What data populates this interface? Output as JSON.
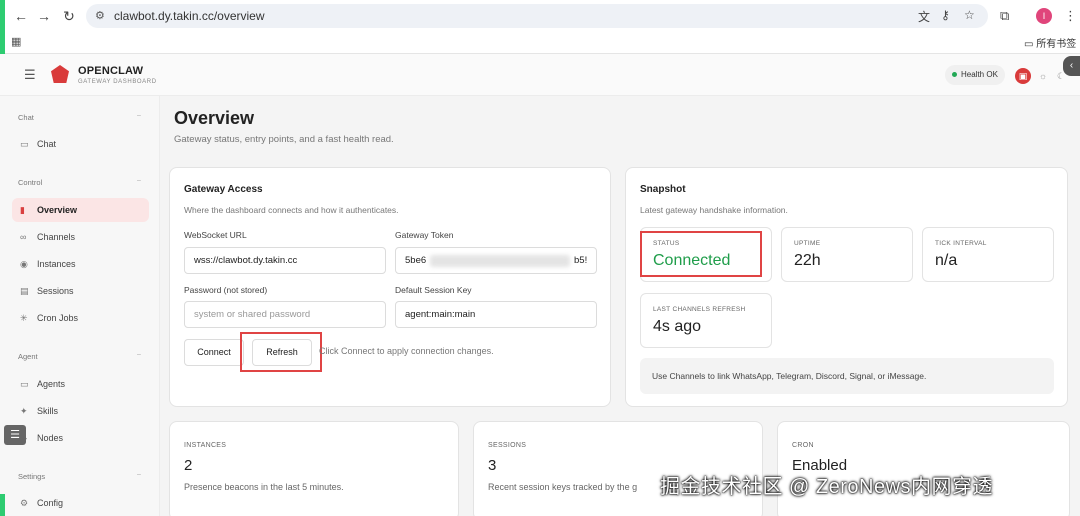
{
  "browser": {
    "url": "clawbot.dy.takin.cc/overview",
    "profile_initial": "I",
    "bookmarks_folder": "所有书签"
  },
  "header": {
    "brand": "OPENCLAW",
    "brand_sub": "GATEWAY DASHBOARD",
    "health_label": "Health",
    "health_status": "OK"
  },
  "sidebar": {
    "sections": [
      {
        "label": "Chat",
        "items": [
          {
            "label": "Chat",
            "icon": "chat-icon"
          }
        ]
      },
      {
        "label": "Control",
        "items": [
          {
            "label": "Overview",
            "icon": "chart-icon",
            "active": true
          },
          {
            "label": "Channels",
            "icon": "link-icon"
          },
          {
            "label": "Instances",
            "icon": "radio-icon"
          },
          {
            "label": "Sessions",
            "icon": "document-icon"
          },
          {
            "label": "Cron Jobs",
            "icon": "loader-icon"
          }
        ]
      },
      {
        "label": "Agent",
        "items": [
          {
            "label": "Agents",
            "icon": "folder-icon"
          },
          {
            "label": "Skills",
            "icon": "sparkle-icon"
          },
          {
            "label": "Nodes",
            "icon": "node-icon"
          }
        ]
      },
      {
        "label": "Settings",
        "items": [
          {
            "label": "Config",
            "icon": "gear-icon"
          }
        ]
      }
    ]
  },
  "page": {
    "title": "Overview",
    "subtitle": "Gateway status, entry points, and a fast health read."
  },
  "gateway_access": {
    "title": "Gateway Access",
    "subtitle": "Where the dashboard connects and how it authenticates.",
    "websocket_label": "WebSocket URL",
    "websocket_value": "wss://clawbot.dy.takin.cc",
    "token_label": "Gateway Token",
    "token_prefix": "5be6",
    "token_suffix": "b5!",
    "password_label": "Password (not stored)",
    "password_placeholder": "system or shared password",
    "session_key_label": "Default Session Key",
    "session_key_value": "agent:main:main",
    "connect_label": "Connect",
    "refresh_label": "Refresh",
    "hint": "Click Connect to apply connection changes."
  },
  "snapshot": {
    "title": "Snapshot",
    "subtitle": "Latest gateway handshake information.",
    "status_label": "STATUS",
    "status_value": "Connected",
    "uptime_label": "UPTIME",
    "uptime_value": "22h",
    "tick_label": "TICK INTERVAL",
    "tick_value": "n/a",
    "refresh_label": "LAST CHANNELS REFRESH",
    "refresh_value": "4s ago",
    "note": "Use Channels to link WhatsApp, Telegram, Discord, Signal, or iMessage.",
    "status_color": "#1f9d4a"
  },
  "bottom_cards": [
    {
      "label": "INSTANCES",
      "value": "2",
      "sub": "Presence beacons in the last 5 minutes."
    },
    {
      "label": "SESSIONS",
      "value": "3",
      "sub": "Recent session keys tracked by the g"
    },
    {
      "label": "CRON",
      "value": "Enabled",
      "sub": ""
    }
  ],
  "watermark": "掘金技术社区 @ ZeroNews内网穿透",
  "colors": {
    "accent": "#d93b3b",
    "annotation": "#e04444",
    "green": "#2ecc71"
  }
}
